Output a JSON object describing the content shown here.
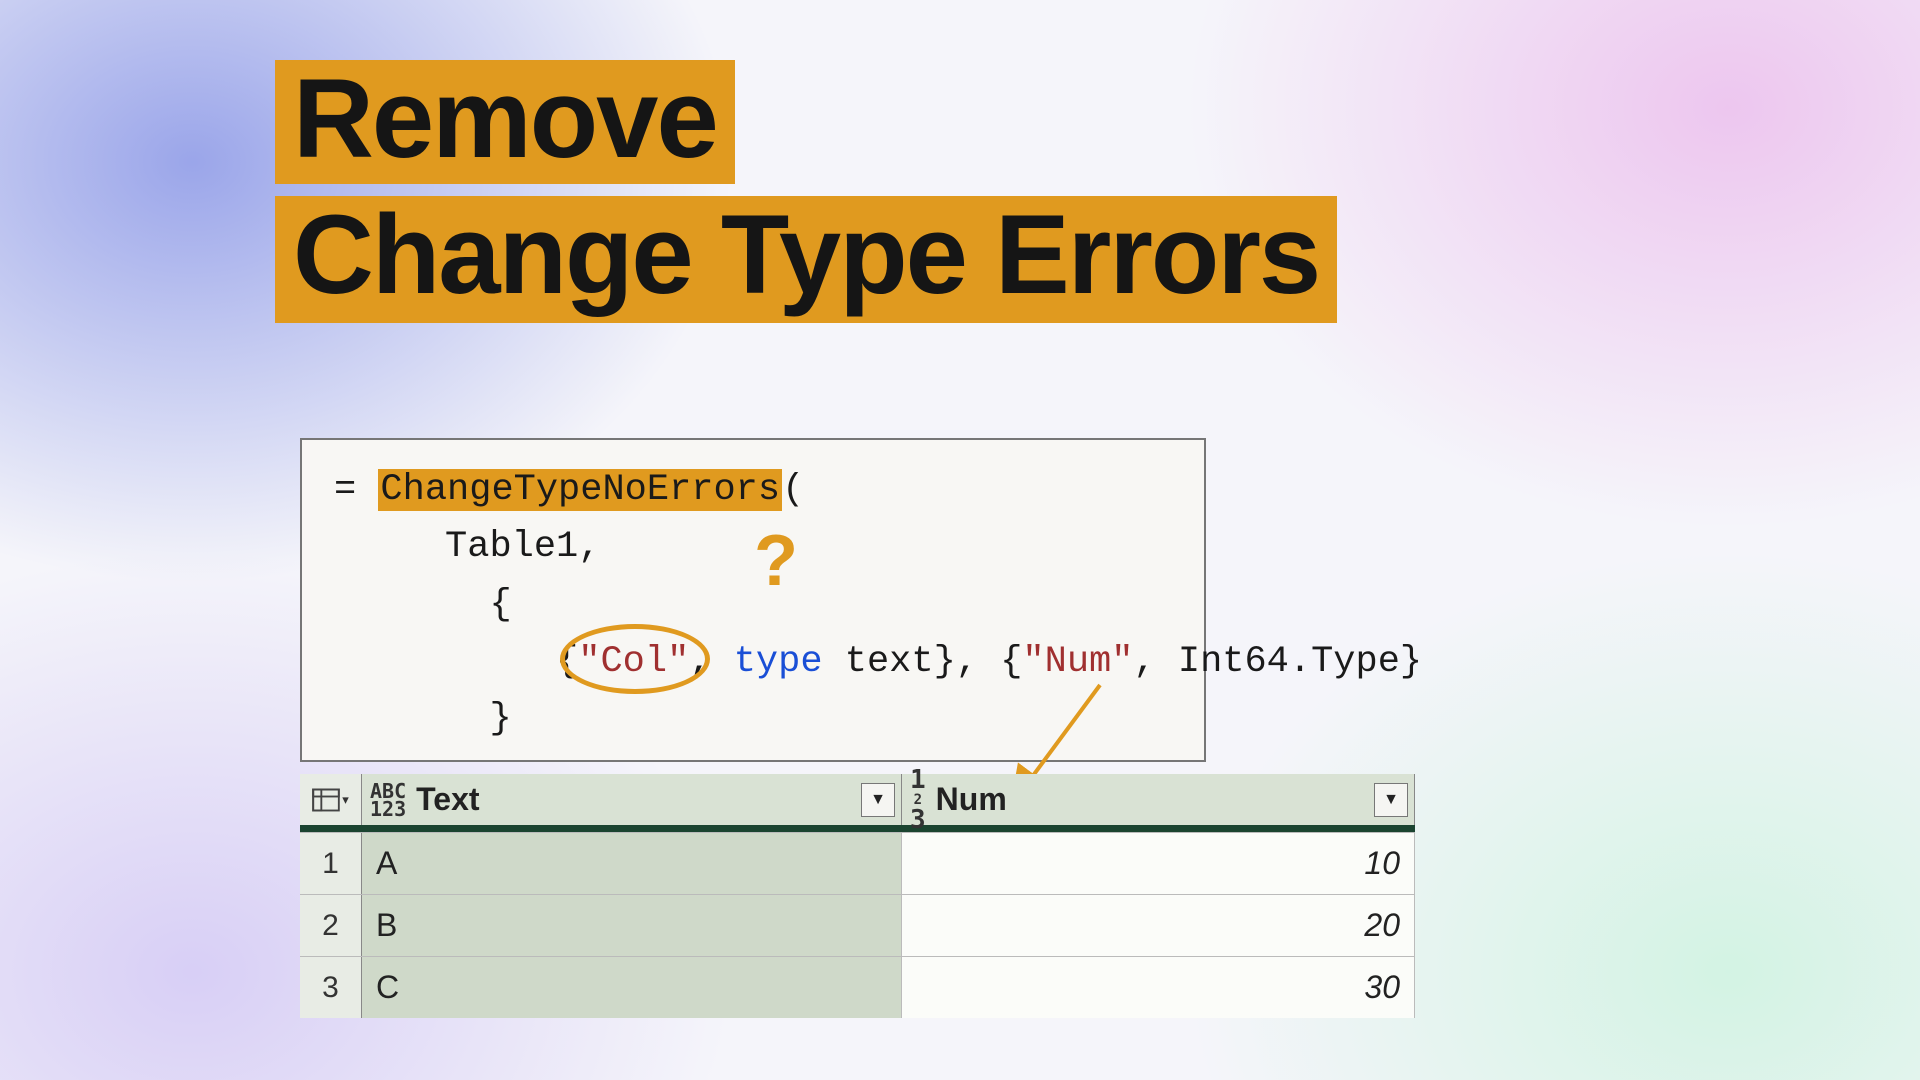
{
  "title": {
    "line1": "Remove",
    "line2": "Change Type Errors"
  },
  "formula": {
    "eq": "= ",
    "fn": "ChangeTypeNoErrors",
    "arg_table": "Table1",
    "open_list": "{",
    "pair1_col": "\"Col\"",
    "pair1_typekw": "type",
    "pair1_typeval": "text",
    "pair2_col": "\"Num\"",
    "pair2_typeval": "Int64.Type",
    "close_list": "}"
  },
  "annotation": {
    "question_mark": "?"
  },
  "table": {
    "columns": [
      {
        "type_icon": "ABC123",
        "label": "Text"
      },
      {
        "type_icon": "123",
        "label": "Num"
      }
    ],
    "rows": [
      {
        "idx": "1",
        "text": "A",
        "num": "10"
      },
      {
        "idx": "2",
        "text": "B",
        "num": "20"
      },
      {
        "idx": "3",
        "text": "C",
        "num": "30"
      }
    ]
  }
}
